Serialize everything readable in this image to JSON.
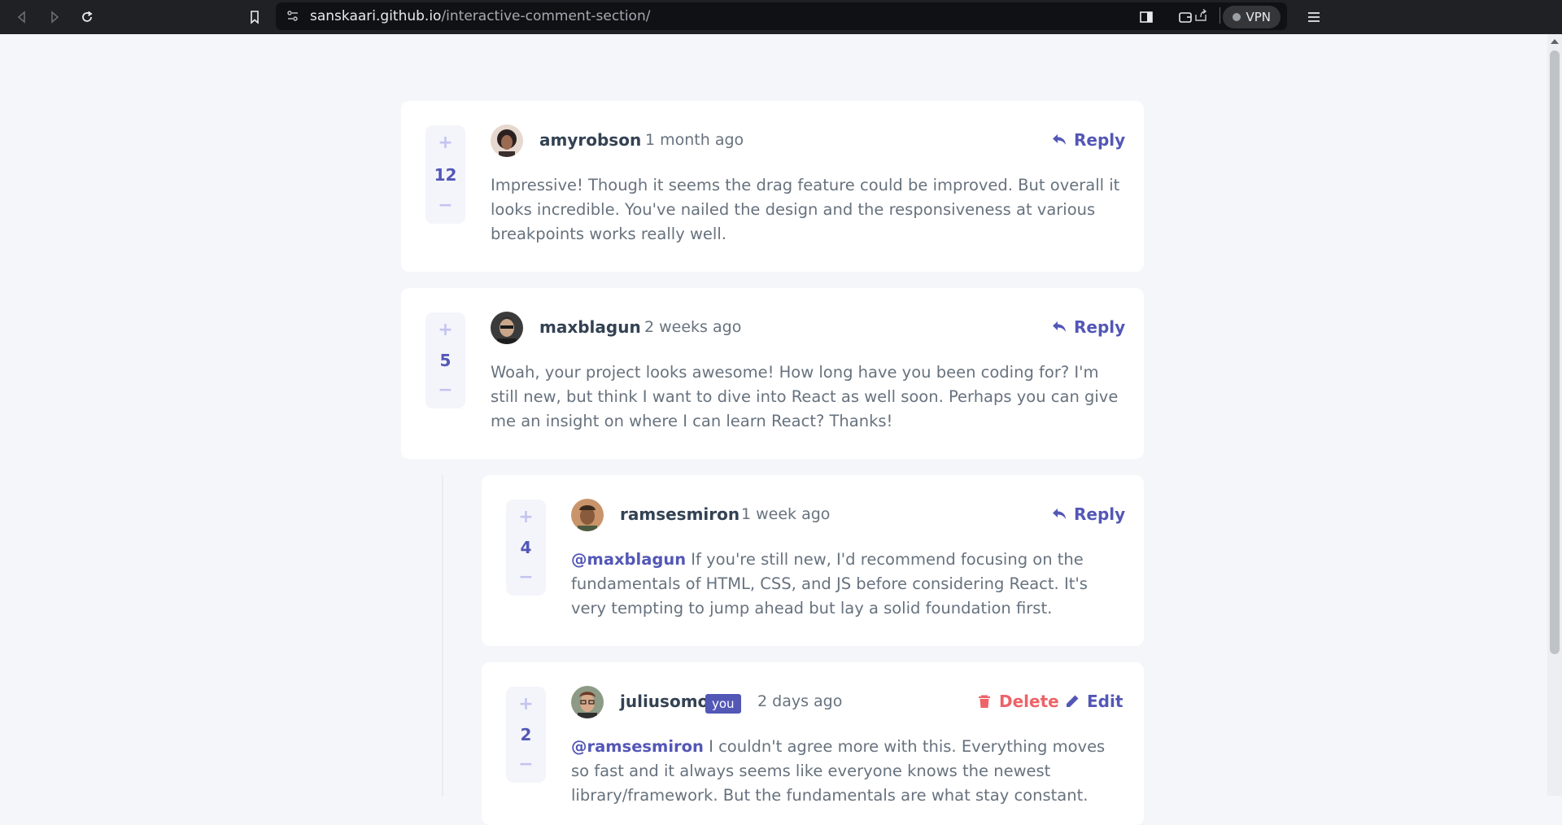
{
  "browser": {
    "url_host": "sanskaari.github.io",
    "url_path": "/interactive-comment-section/",
    "vpn_label": "VPN"
  },
  "comments": [
    {
      "username": "amyrobson",
      "time": "1 month ago",
      "score": "12",
      "action": "Reply",
      "content": "Impressive! Though it seems the drag feature could be improved. But overall it looks incredible. You've nailed the design and the responsiveness at various breakpoints works really well."
    },
    {
      "username": "maxblagun",
      "time": "2 weeks ago",
      "score": "5",
      "action": "Reply",
      "content": "Woah, your project looks awesome! How long have you been coding for? I'm still new, but think I want to dive into React as well soon. Perhaps you can give me an insight on where I can learn React? Thanks!"
    }
  ],
  "replies": [
    {
      "username": "ramsesmiron",
      "time": "1 week ago",
      "score": "4",
      "action": "Reply",
      "mention": "@maxblagun",
      "content": "If you're still new, I'd recommend focusing on the fundamentals of HTML, CSS, and JS before considering React. It's very tempting to jump ahead but lay a solid foundation first."
    },
    {
      "username": "juliusomo",
      "you_badge": "you",
      "time": "2 days ago",
      "score": "2",
      "delete_label": "Delete",
      "edit_label": "Edit",
      "mention": "@ramsesmiron",
      "content": "I couldn't agree more with this. Everything moves so fast and it always seems like everyone knows the newest library/framework. But the fundamentals are what stay constant."
    }
  ],
  "vote": {
    "plus": "+",
    "minus": "−"
  },
  "colors": {
    "accent": "#5357b6",
    "danger": "#ed6368",
    "text": "#67727e",
    "heading": "#334253",
    "background": "#f5f6fa"
  }
}
